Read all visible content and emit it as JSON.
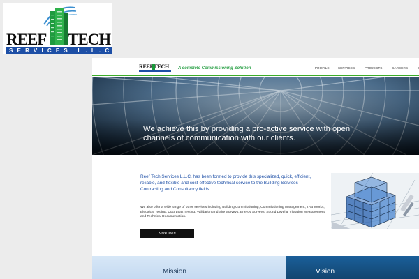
{
  "logo": {
    "word1": "REEF",
    "word2": "TECH",
    "subtitle": "SERVICES L.L.C.",
    "brand_blue": "#1d4fa6",
    "brand_green": "#1a9a3a"
  },
  "site": {
    "header": {
      "mini_logo": "REEF TECH",
      "tagline": "A complete Commissioning Solution",
      "nav": [
        "PROFILE",
        "SERVICES",
        "PROJECTS",
        "CAREERS",
        "C"
      ]
    },
    "hero": {
      "text": "We achieve this by providing a pro-active service with open channels of communication with our clients."
    },
    "intro": "Reef Tech Services L.L.C. has been formed to provide this specialized, quick, efficient, reliable, and flexible and cost-effective technical service to the Building Services Contracting and Consultancy fields.",
    "description": "We also offer a wide range of other services including Building Commissioning, Commissioning Management, TAB Works, Electrical Testing, Duct Leak Testing, Validation and Site Surveys, Energy Surveys, Sound Level & Vibration Measurement, and Technical Documentation.",
    "know_more": "know more",
    "panels": {
      "mission": "Mission",
      "vision": "Vision"
    },
    "accent_green": "#3cad2a"
  }
}
